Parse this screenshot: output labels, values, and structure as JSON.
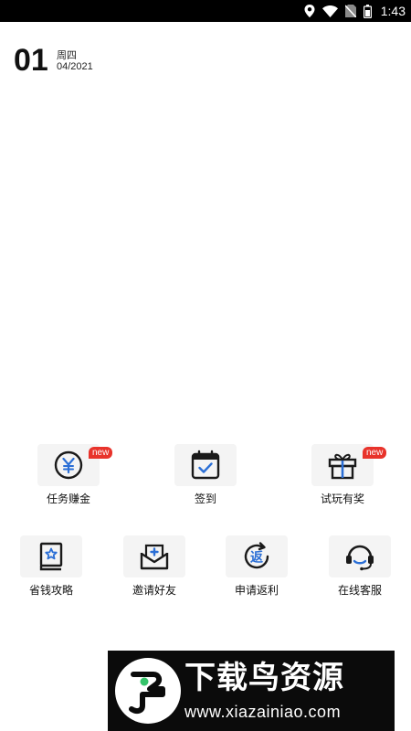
{
  "status_bar": {
    "time": "1:43",
    "icons": [
      "location-icon",
      "wifi-icon",
      "no-sim-icon",
      "battery-icon"
    ]
  },
  "date": {
    "day": "01",
    "weekday": "周四",
    "month_year": "04/2021"
  },
  "grid_top": [
    {
      "label": "任务赚金",
      "icon": "yuan-coin-icon",
      "badge": "new"
    },
    {
      "label": "签到",
      "icon": "calendar-check-icon",
      "badge": ""
    },
    {
      "label": "试玩有奖",
      "icon": "gift-icon",
      "badge": "new"
    }
  ],
  "grid_bottom": [
    {
      "label": "省钱攻略",
      "icon": "star-book-icon"
    },
    {
      "label": "邀请好友",
      "icon": "invite-envelope-icon"
    },
    {
      "label": "申请返利",
      "icon": "rebate-return-icon"
    },
    {
      "label": "在线客服",
      "icon": "headset-icon"
    }
  ],
  "watermark": {
    "title": "下载鸟资源",
    "url": "www.xiazainiao.com"
  },
  "colors": {
    "badge": "#e8332b",
    "accent_blue": "#2b6fd6",
    "tile_bg": "#f4f4f4",
    "status_bar": "#000000"
  }
}
